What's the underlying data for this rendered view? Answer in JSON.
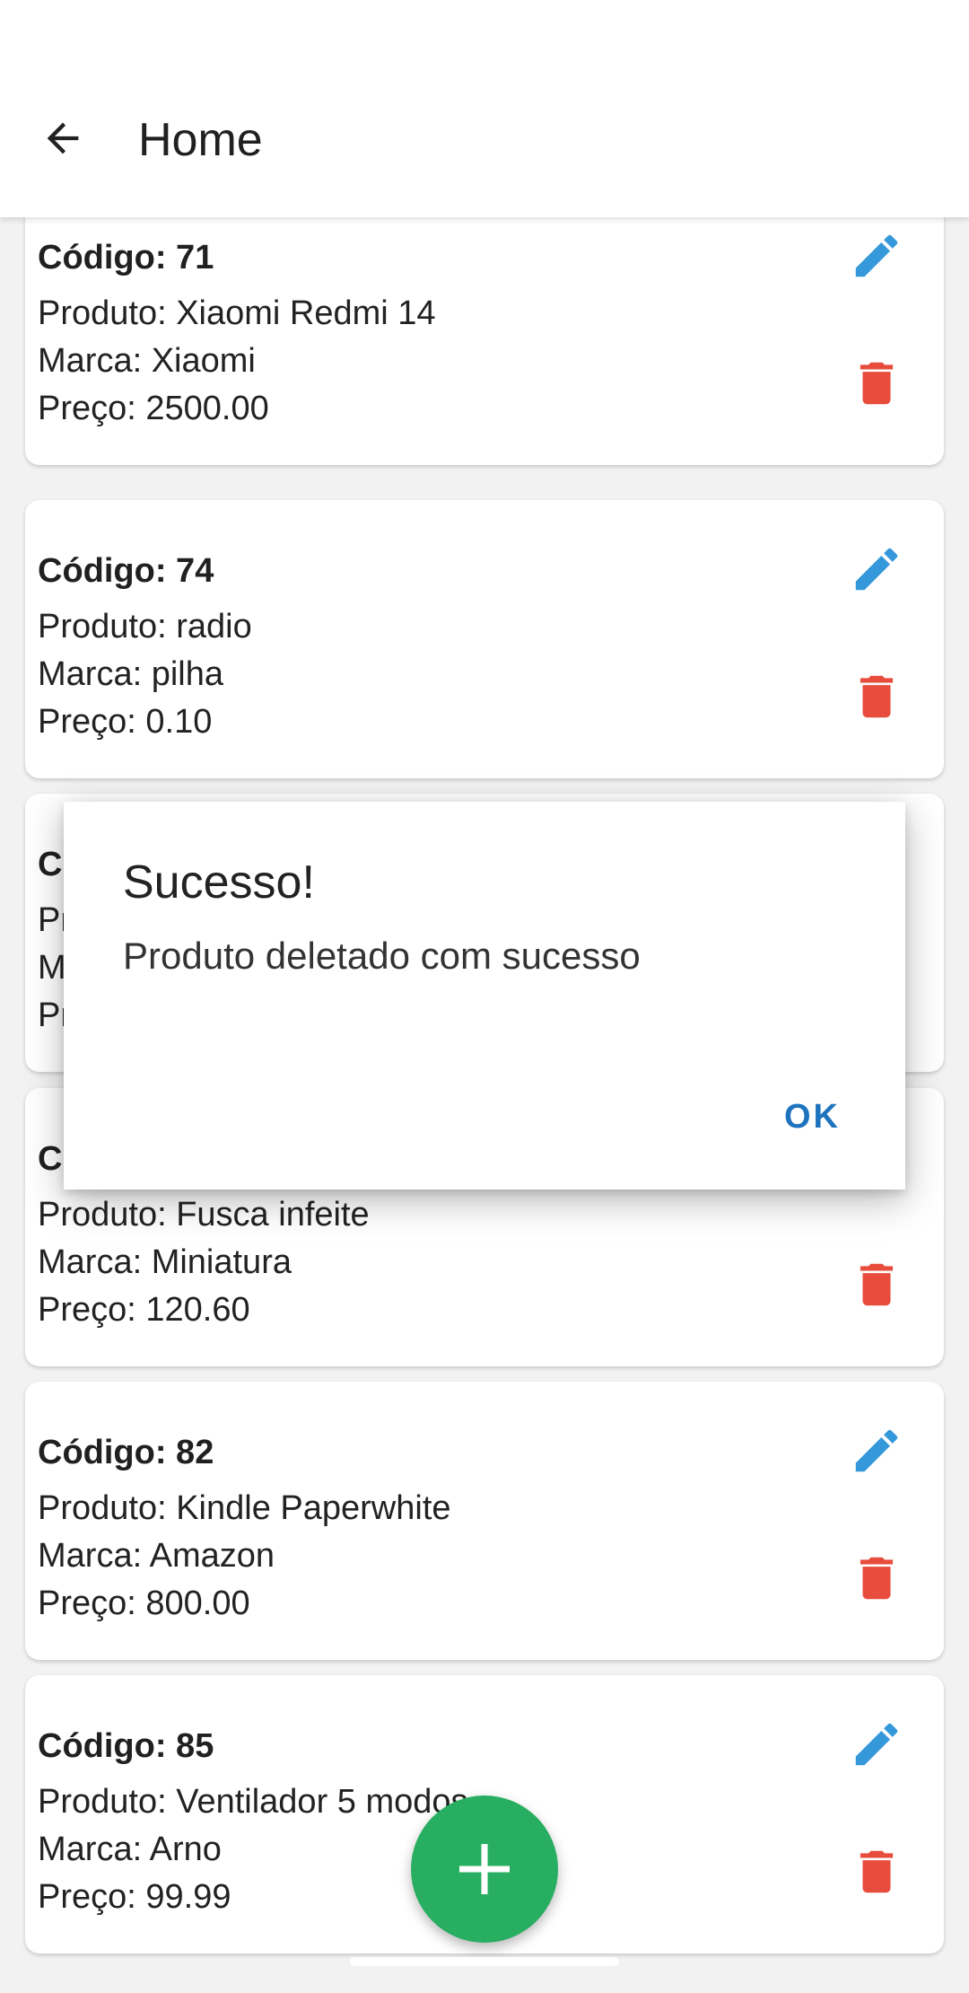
{
  "appbar": {
    "title": "Home",
    "back_icon": "arrow-back-icon"
  },
  "products": [
    {
      "code": "Código: 71",
      "product": "Produto: Xiaomi Redmi 14",
      "brand": "Marca: Xiaomi",
      "price": "Preço: 2500.00"
    },
    {
      "code": "Código: 74",
      "product": "Produto: radio",
      "brand": "Marca: pilha",
      "price": "Preço: 0.10"
    },
    {
      "code": "Có",
      "product": "Pr",
      "brand": "M",
      "price": "Pr"
    },
    {
      "code": "Có",
      "product": "Produto: Fusca infeite",
      "brand": "Marca: Miniatura",
      "price": "Preço: 120.60"
    },
    {
      "code": "Código: 82",
      "product": "Produto: Kindle Paperwhite",
      "brand": "Marca: Amazon",
      "price": "Preço: 800.00"
    },
    {
      "code": "Código: 85",
      "product": "Produto: Ventilador 5 modos",
      "brand": "Marca: Arno",
      "price": "Preço: 99.99"
    }
  ],
  "dialog": {
    "title": "Sucesso!",
    "message": "Produto deletado com sucesso",
    "ok_label": "OK"
  },
  "colors": {
    "edit": "#3498db",
    "delete": "#e74c3c",
    "fab": "#27ae60",
    "dialog_button": "#1e73be"
  },
  "icons": {
    "edit": "pencil-icon",
    "delete": "trash-icon",
    "fab": "plus-icon"
  }
}
